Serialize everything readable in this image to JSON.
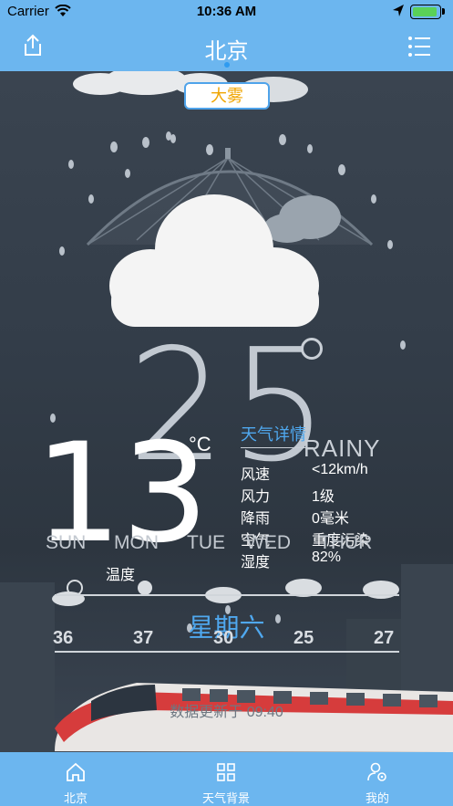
{
  "status": {
    "carrier": "Carrier",
    "time": "10:36 AM"
  },
  "nav": {
    "title": "北京"
  },
  "weather": {
    "badge": "大雾",
    "big_temp": "25",
    "current_temp": "13",
    "unit": "°C",
    "condition_en": "RAINY",
    "detail_link": "天气详情",
    "details": [
      {
        "k": "风速",
        "v": "<12km/h"
      },
      {
        "k": "风力",
        "v": "1级"
      },
      {
        "k": "降雨",
        "v": "0毫米"
      },
      {
        "k": "空气",
        "v": "重度污染"
      },
      {
        "k": "湿度",
        "v": "82%"
      }
    ],
    "days": [
      "SUN",
      "MON",
      "TUE",
      "WED",
      "THUR"
    ],
    "temp_label": "温度",
    "weekday": "星期六",
    "highs": [
      "36",
      "37",
      "30",
      "25",
      "27"
    ],
    "update": "数据更新于 09:40"
  },
  "tabs": [
    {
      "label": "北京",
      "icon": "home-icon"
    },
    {
      "label": "天气背景",
      "icon": "grid-icon"
    },
    {
      "label": "我的",
      "icon": "user-settings-icon"
    }
  ],
  "colors": {
    "bar": "#6cb6ef",
    "accent": "#4fa8ef",
    "badge_text": "#f0a500"
  }
}
